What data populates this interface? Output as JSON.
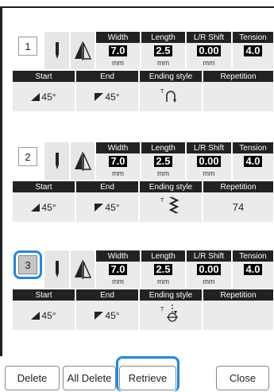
{
  "header_labels": {
    "width": "Width",
    "length": "Length",
    "lr_shift": "L/R Shift",
    "tension": "Tension",
    "start": "Start",
    "end": "End",
    "ending_style": "Ending style",
    "repetition": "Repetition"
  },
  "cards": [
    {
      "number": "1",
      "selected": false,
      "width": "7.0",
      "width_unit": "mm",
      "length": "2.5",
      "length_unit": "mm",
      "lr_shift": "0.00",
      "lr_shift_unit": "mm",
      "tension": "4.0",
      "start_angle": "45°",
      "end_angle": "45°",
      "ending_style_icon": "tie-off-loop-icon",
      "repetition": ""
    },
    {
      "number": "2",
      "selected": false,
      "width": "7.0",
      "width_unit": "mm",
      "length": "2.5",
      "length_unit": "mm",
      "lr_shift": "0.00",
      "lr_shift_unit": "mm",
      "tension": "4.0",
      "start_angle": "45°",
      "end_angle": "45°",
      "ending_style_icon": "repeat-stitch-icon",
      "repetition": "74"
    },
    {
      "number": "3",
      "selected": true,
      "width": "7.0",
      "width_unit": "mm",
      "length": "2.5",
      "length_unit": "mm",
      "lr_shift": "0.00",
      "lr_shift_unit": "mm",
      "tension": "4.0",
      "start_angle": "45°",
      "end_angle": "45°",
      "ending_style_icon": "stop-stitch-icon",
      "repetition": ""
    }
  ],
  "buttons": {
    "delete": "Delete",
    "all_delete": "All Delete",
    "retrieve": "Retrieve",
    "close": "Close"
  },
  "colors": {
    "highlight": "#1e88e5",
    "header_bg": "#222222",
    "cell_bg": "#ebebeb"
  }
}
